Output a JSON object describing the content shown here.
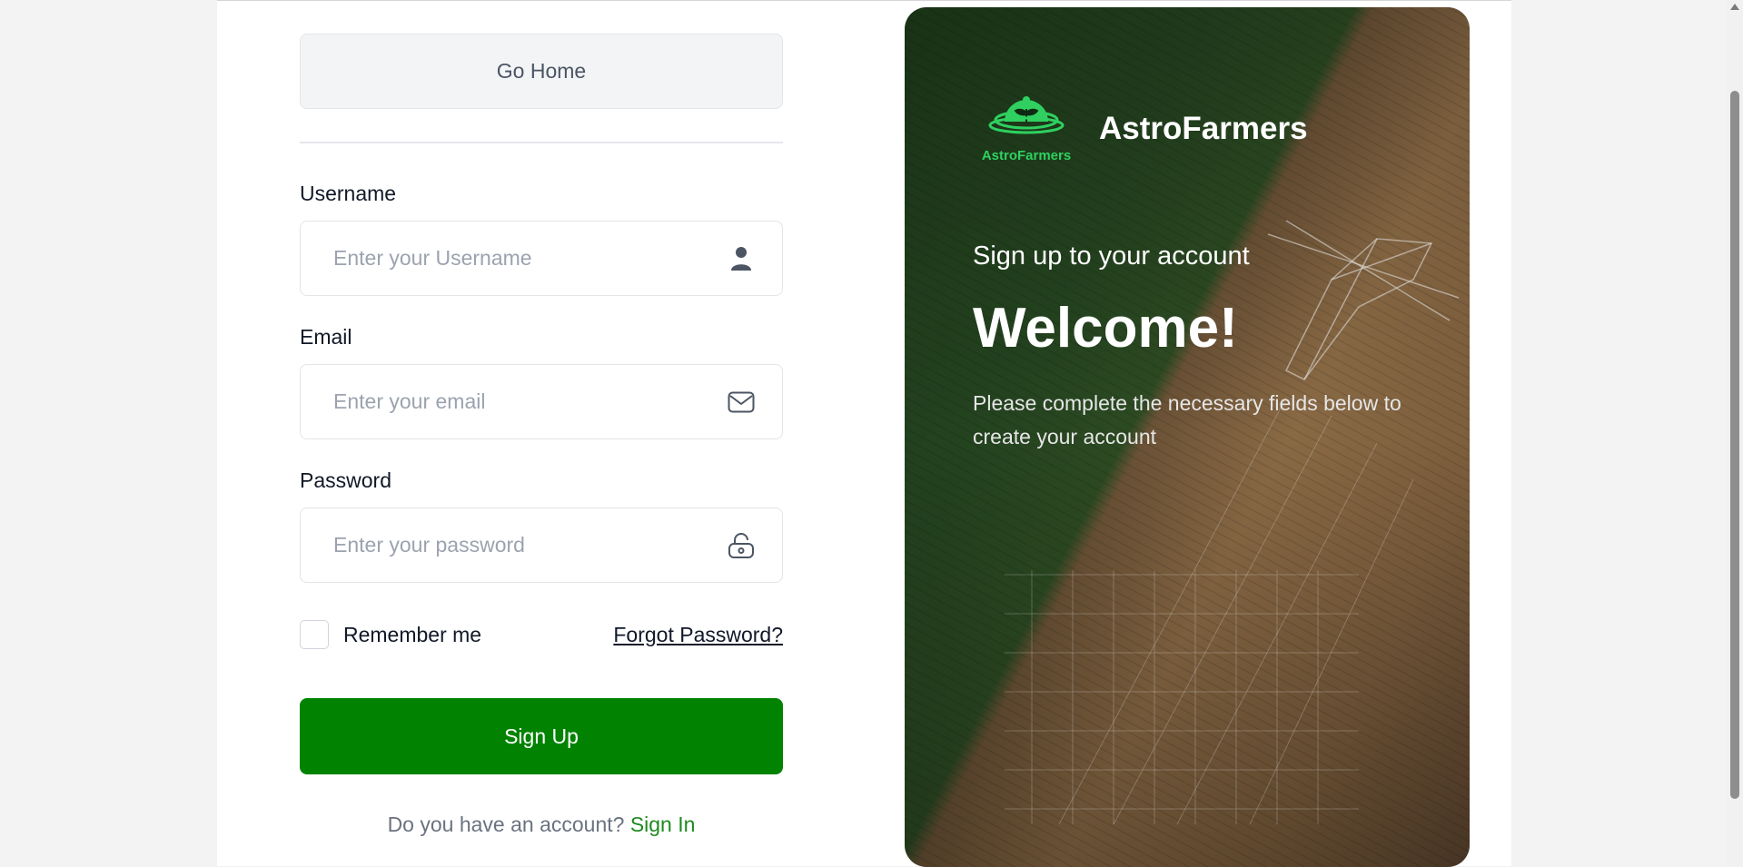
{
  "form": {
    "go_home_label": "Go Home",
    "username": {
      "label": "Username",
      "placeholder": "Enter your Username",
      "icon": "user-icon"
    },
    "email": {
      "label": "Email",
      "placeholder": "Enter your email",
      "icon": "mail-icon"
    },
    "password": {
      "label": "Password",
      "placeholder": "Enter your password",
      "icon": "lock-icon"
    },
    "remember_label": "Remember me",
    "forgot_label": "Forgot Password?",
    "signup_label": "Sign Up",
    "signin_prompt": "Do you have an account?",
    "signin_label": "Sign In"
  },
  "hero": {
    "logo_text": "AstroFarmers",
    "brand_name": "AstroFarmers",
    "subtitle": "Sign up to your account",
    "title": "Welcome!",
    "description": "Please complete the necessary fields below to create your account"
  },
  "colors": {
    "primary_green": "#018301",
    "link_green": "#1e8a1e",
    "logo_green": "#2fd060"
  }
}
